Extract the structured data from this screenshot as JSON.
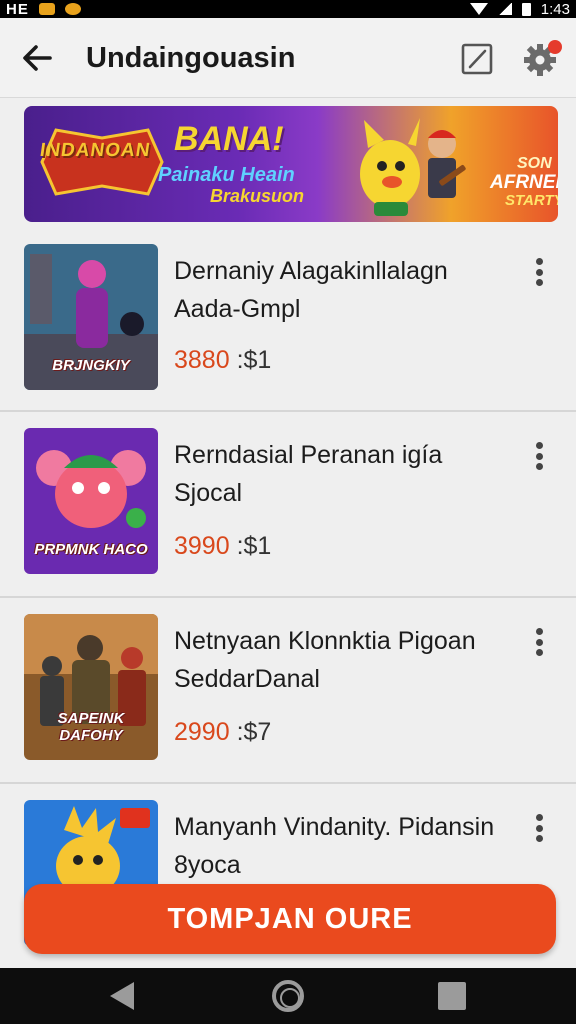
{
  "status_bar": {
    "carrier": "HE",
    "time": "1:43"
  },
  "appbar": {
    "title": "Undaingouasin",
    "back_icon": "arrow-left-icon",
    "edit_icon": "edit-square-icon",
    "settings_icon": "gear-icon"
  },
  "banner": {
    "logo_text": "INDANOAN",
    "headline": "BANA!",
    "line1": "Painaku Heain",
    "line2": "Brakusuon",
    "side_line1": "SON",
    "side_line2": "AFRNELL",
    "side_line3": "STARTY"
  },
  "items": [
    {
      "name": "Dernaniy Alagakinllalagn Aada-Gmpl",
      "price_highlight": "3880",
      "price_rest": " :$1",
      "badge": "BRJNGKIY",
      "accent": "#7b2a8e"
    },
    {
      "name": "Rerndasial Peranan igía Sjocal",
      "price_highlight": "3990",
      "price_rest": " :$1",
      "badge": "PRPMNK HACO",
      "accent": "#7a2ab0"
    },
    {
      "name": "Netnyaan Klonnktia Pigoan SeddarDanal",
      "price_highlight": "2990",
      "price_rest": " :$7",
      "badge": "SAPEINK DAFOHY",
      "accent": "#8a4a1a"
    },
    {
      "name": "Manyanh Vindanity. Pidansin 8yoca",
      "price_highlight": "",
      "price_rest": "",
      "badge": "",
      "accent": "#2a7ad8"
    }
  ],
  "cta": {
    "label": "TOMPJAN OURE"
  },
  "colors": {
    "accent": "#ea4a1e",
    "price": "#d9481c"
  }
}
